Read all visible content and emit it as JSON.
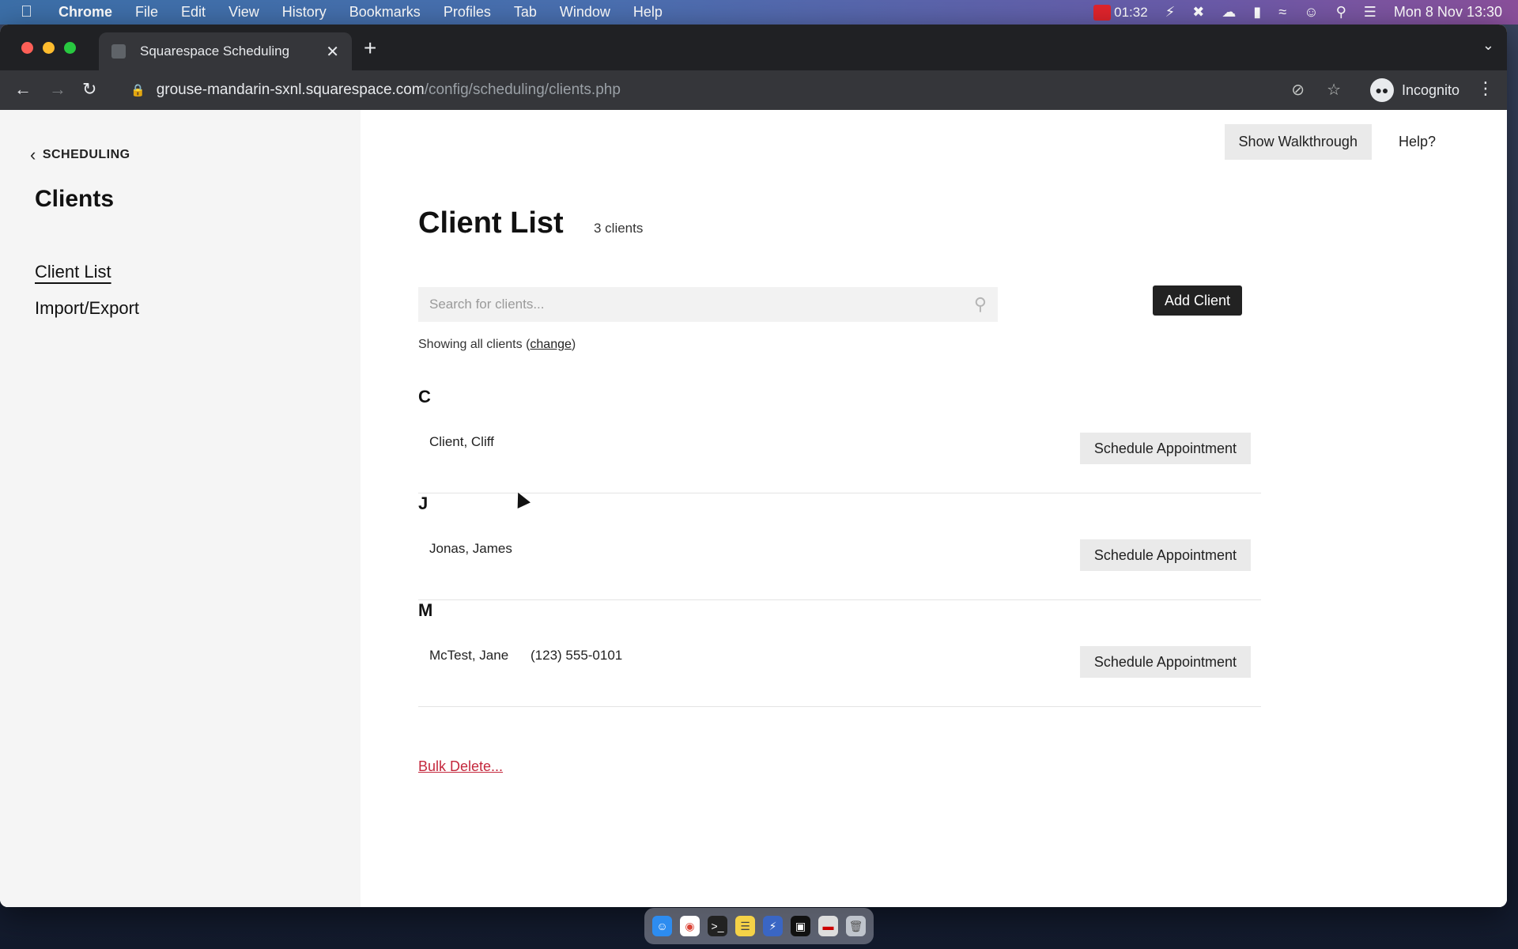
{
  "menubar": {
    "app_name": "Chrome",
    "items": [
      "File",
      "Edit",
      "View",
      "History",
      "Bookmarks",
      "Profiles",
      "Tab",
      "Window",
      "Help"
    ],
    "timer": "01:32",
    "clock": "Mon 8 Nov  13:30"
  },
  "browser": {
    "tab_title": "Squarespace Scheduling",
    "url_host": "grouse-mandarin-sxnl.squarespace.com",
    "url_path": "/config/scheduling/clients.php",
    "profile_label": "Incognito"
  },
  "sidebar": {
    "back_label": "SCHEDULING",
    "title": "Clients",
    "items": [
      {
        "label": "Client List",
        "active": true
      },
      {
        "label": "Import/Export",
        "active": false
      }
    ]
  },
  "header": {
    "walkthrough_label": "Show Walkthrough",
    "help_label": "Help?"
  },
  "main": {
    "title": "Client List",
    "count": "3 clients",
    "search_placeholder": "Search for clients...",
    "add_client_label": "Add Client",
    "filter_prefix": "Showing all clients (",
    "filter_link": "change",
    "filter_suffix": ")",
    "schedule_label": "Schedule Appointment",
    "bulk_delete_label": "Bulk Delete...",
    "groups": [
      {
        "letter": "C",
        "name": "Client, Cliff",
        "phone": ""
      },
      {
        "letter": "J",
        "name": "Jonas, James",
        "phone": ""
      },
      {
        "letter": "M",
        "name": "McTest, Jane",
        "phone": "(123) 555-0101"
      }
    ]
  }
}
